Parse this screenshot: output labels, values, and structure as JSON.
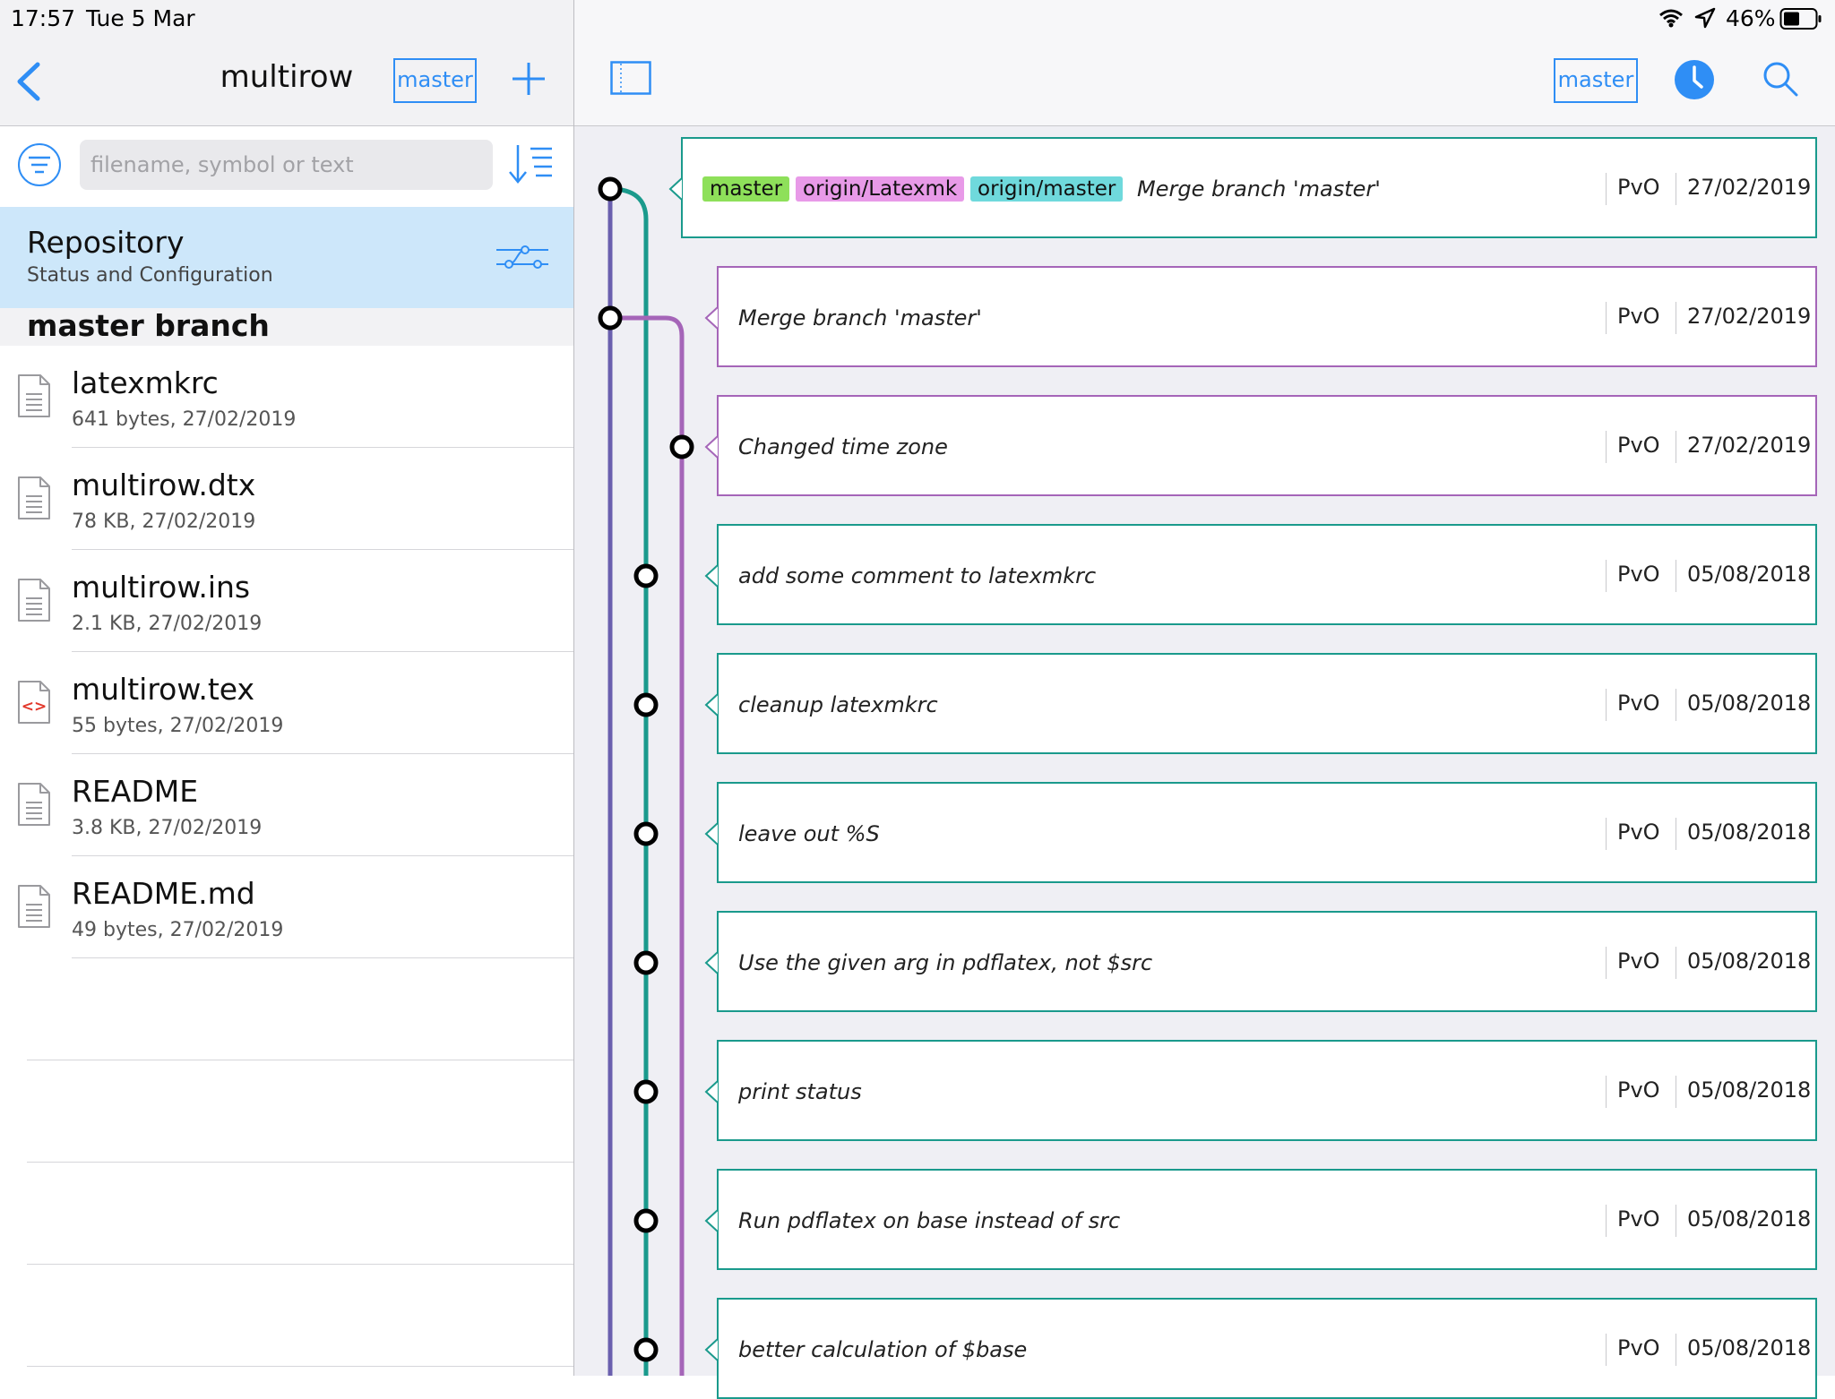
{
  "status_bar": {
    "time": "17:57",
    "date": "Tue 5 Mar",
    "battery": "46%"
  },
  "left_header": {
    "title": "multirow",
    "branch_button": "master"
  },
  "search": {
    "placeholder": "filename, symbol or text"
  },
  "repository_row": {
    "title": "Repository",
    "subtitle": "Status and Configuration"
  },
  "section": {
    "title": "master branch"
  },
  "files": [
    {
      "name": "latexmkrc",
      "meta": "641 bytes, 27/02/2019",
      "icon": "text-file-icon"
    },
    {
      "name": "multirow.dtx",
      "meta": "78 KB, 27/02/2019",
      "icon": "text-file-icon"
    },
    {
      "name": "multirow.ins",
      "meta": "2.1 KB, 27/02/2019",
      "icon": "text-file-icon"
    },
    {
      "name": "multirow.tex",
      "meta": "55 bytes, 27/02/2019",
      "icon": "code-file-icon"
    },
    {
      "name": "README",
      "meta": "3.8 KB, 27/02/2019",
      "icon": "text-file-icon"
    },
    {
      "name": "README.md",
      "meta": "49 bytes, 27/02/2019",
      "icon": "text-file-icon"
    }
  ],
  "right_header": {
    "branch_button": "master"
  },
  "commits": [
    {
      "message": "Merge branch 'master'",
      "author": "PvO",
      "date": "27/02/2019",
      "tags": [
        {
          "label": "master",
          "color": "#8ee05a"
        },
        {
          "label": "origin/Latexmk",
          "color": "#e89ae8"
        },
        {
          "label": "origin/master",
          "color": "#6fd9dc"
        }
      ]
    },
    {
      "message": "Merge branch 'master'",
      "author": "PvO",
      "date": "27/02/2019",
      "tags": []
    },
    {
      "message": "Changed time zone",
      "author": "PvO",
      "date": "27/02/2019",
      "tags": []
    },
    {
      "message": "add some comment to latexmkrc",
      "author": "PvO",
      "date": "05/08/2018",
      "tags": []
    },
    {
      "message": "cleanup latexmkrc",
      "author": "PvO",
      "date": "05/08/2018",
      "tags": []
    },
    {
      "message": "leave out %S",
      "author": "PvO",
      "date": "05/08/2018",
      "tags": []
    },
    {
      "message": "Use the given arg in pdflatex, not $src",
      "author": "PvO",
      "date": "05/08/2018",
      "tags": []
    },
    {
      "message": "print status",
      "author": "PvO",
      "date": "05/08/2018",
      "tags": []
    },
    {
      "message": "Run pdflatex on base instead of src",
      "author": "PvO",
      "date": "05/08/2018",
      "tags": []
    },
    {
      "message": "better calculation of $base",
      "author": "PvO",
      "date": "05/08/2018",
      "tags": []
    }
  ],
  "colors": {
    "accent": "#2f8ef5",
    "lane_purple": "#6a5fae",
    "lane_teal": "#1a9a8c",
    "lane_magenta": "#a565b8",
    "selected_row": "#cde7fa"
  }
}
